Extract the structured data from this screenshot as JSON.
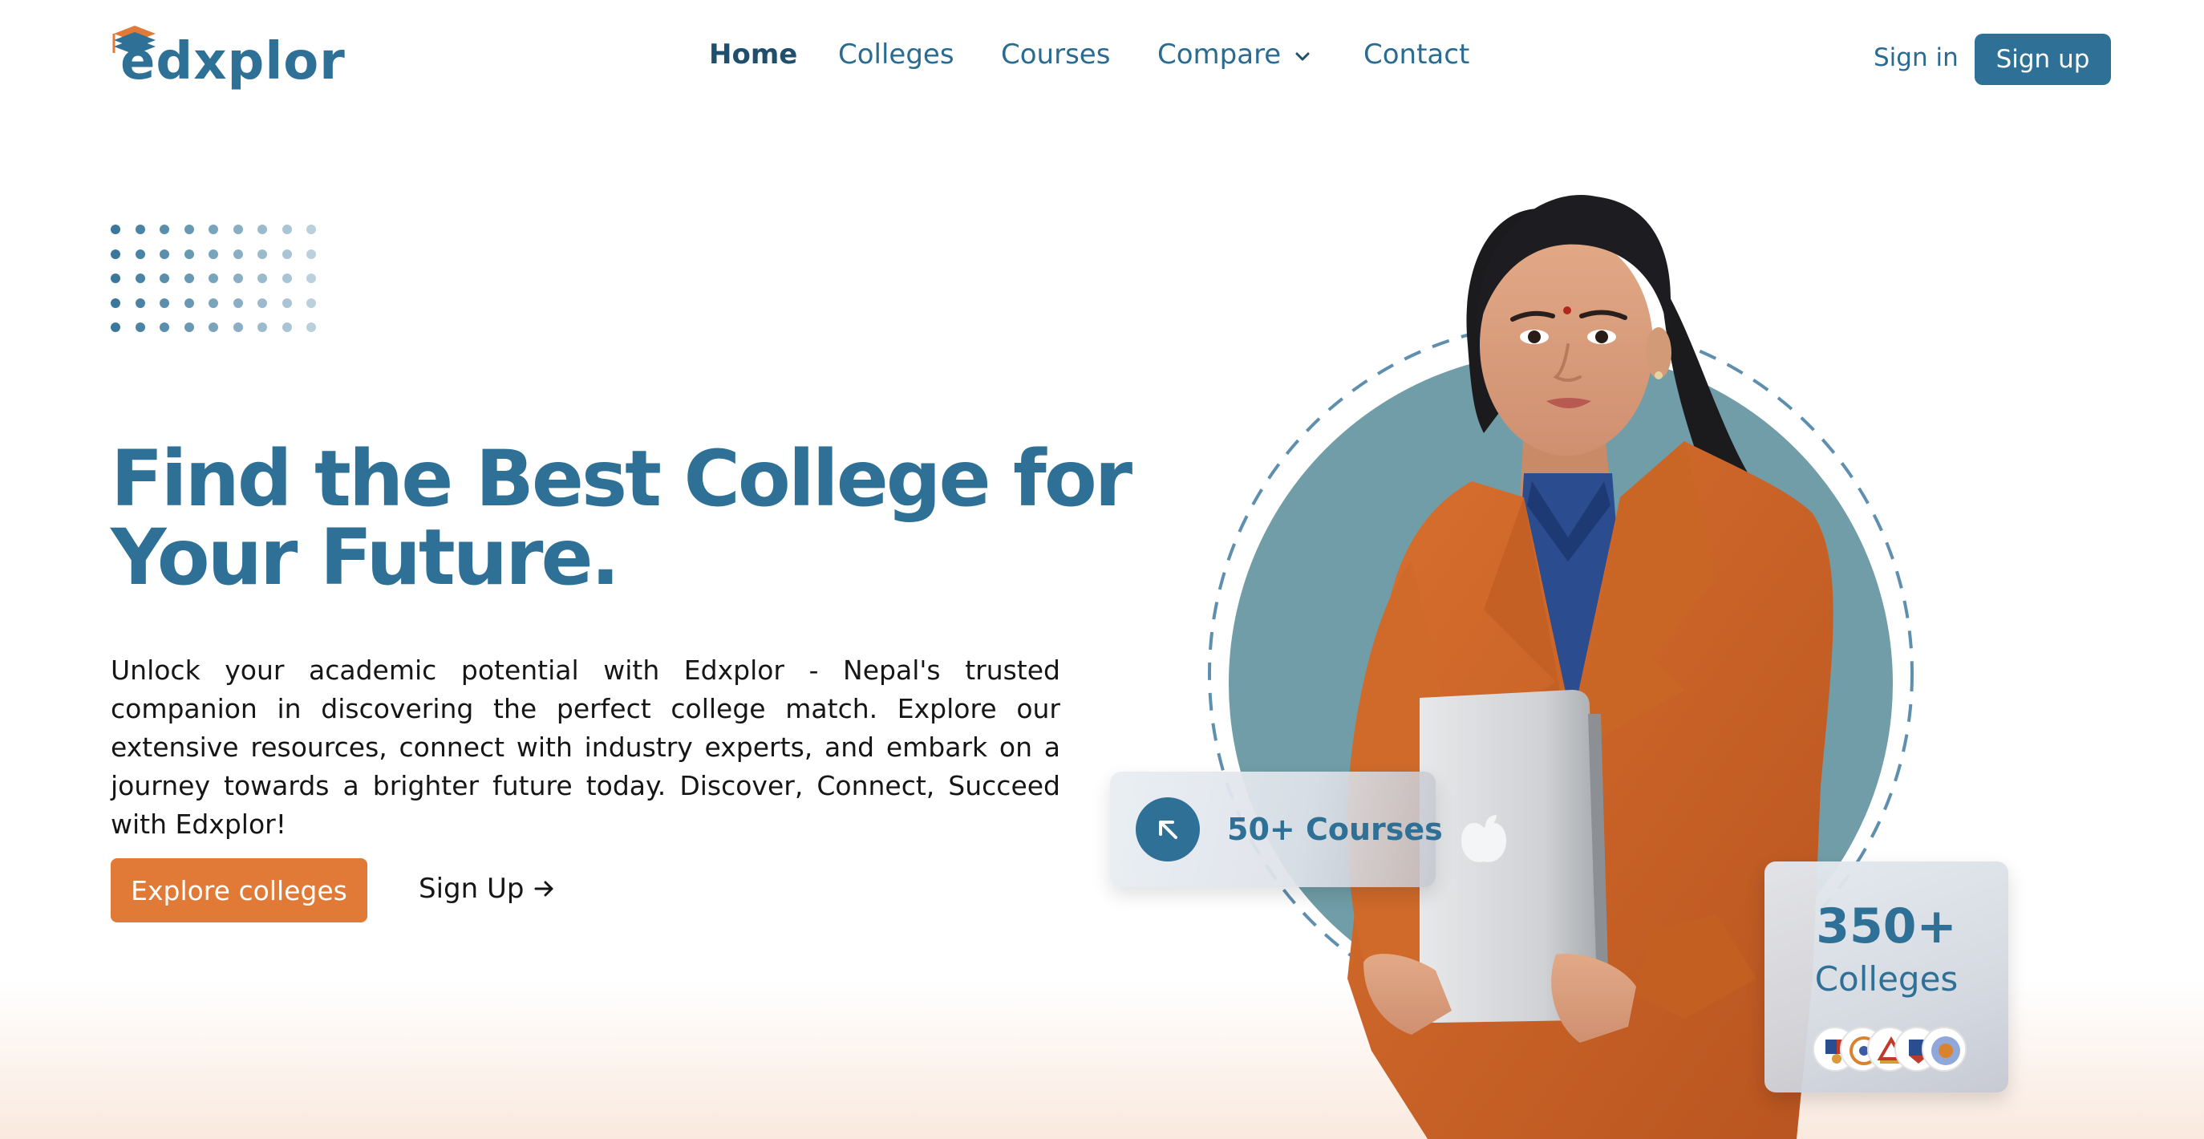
{
  "brand": {
    "name": "edxplor",
    "colors": {
      "primary": "#2f7096",
      "accent": "#e07a36",
      "circle": "#709da7"
    }
  },
  "nav": {
    "links": [
      {
        "label": "Home",
        "active": true
      },
      {
        "label": "Colleges",
        "active": false
      },
      {
        "label": "Courses",
        "active": false
      },
      {
        "label": "Compare",
        "active": false,
        "has_dropdown": true
      },
      {
        "label": "Contact",
        "active": false
      }
    ],
    "signin_label": "Sign in",
    "signup_label": "Sign up"
  },
  "hero": {
    "headline": "Find the Best College for Your Future.",
    "description": "Unlock your academic potential with Edxplor - Nepal's trusted companion in discovering the perfect college match. Explore our extensive resources, connect with industry experts, and embark on a journey towards a brighter future today. Discover, Connect, Succeed with Edxplor!",
    "primary_cta": "Explore colleges",
    "secondary_cta": "Sign Up",
    "image_subject": "student-with-laptop"
  },
  "stats": {
    "courses": {
      "label": "50+ Courses",
      "icon": "arrow-up-left-icon"
    },
    "colleges": {
      "count": "350+",
      "label": "Colleges"
    }
  },
  "icons": {
    "logo": "graduation-cap-icon",
    "compare_dropdown": "chevron-down-icon",
    "signup_arrow": "arrow-right-icon"
  }
}
